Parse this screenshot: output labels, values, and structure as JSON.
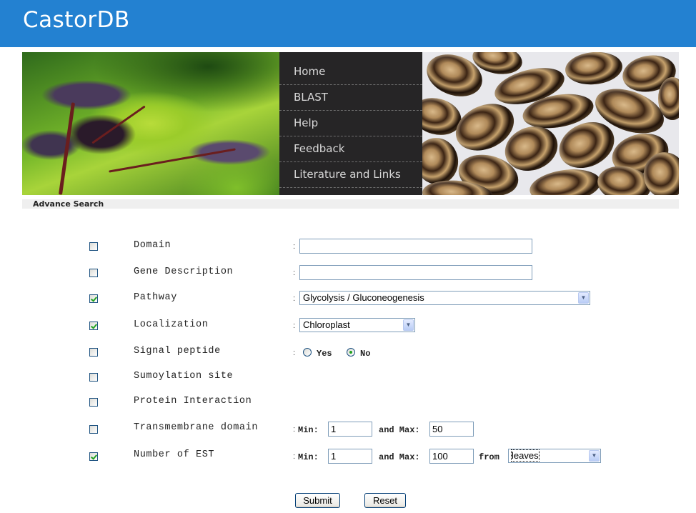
{
  "header": {
    "title": "CastorDB",
    "color": "#2381d1"
  },
  "nav": {
    "items": [
      {
        "label": "Home"
      },
      {
        "label": "BLAST"
      },
      {
        "label": "Help"
      },
      {
        "label": "Feedback"
      },
      {
        "label": "Literature and Links"
      }
    ]
  },
  "subbar": {
    "title": "Advance Search"
  },
  "form": {
    "separator": ":",
    "domain": {
      "label": "Domain",
      "checked": false,
      "value": ""
    },
    "gene_description": {
      "label": "Gene Description",
      "checked": false,
      "value": ""
    },
    "pathway": {
      "label": "Pathway",
      "checked": true,
      "selected": "Glycolysis / Gluconeogenesis"
    },
    "localization": {
      "label": "Localization",
      "checked": true,
      "selected": "Chloroplast"
    },
    "signal_peptide": {
      "label": "Signal peptide",
      "checked": false,
      "options": [
        {
          "label": "Yes",
          "selected": false
        },
        {
          "label": "No",
          "selected": true
        }
      ]
    },
    "sumoylation": {
      "label": "Sumoylation site",
      "checked": false
    },
    "protein_interaction": {
      "label": "Protein Interaction",
      "checked": false
    },
    "transmembrane": {
      "label": "Transmembrane domain",
      "checked": false,
      "min_label": "Min:",
      "min": "1",
      "max_label": "and Max:",
      "max": "50"
    },
    "est": {
      "label": "Number of EST",
      "checked": true,
      "min_label": "Min:",
      "min": "1",
      "max_label": "and Max:",
      "max": "100",
      "from_label": "from",
      "from_selected": "leaves"
    }
  },
  "buttons": {
    "submit": "Submit",
    "reset": "Reset"
  },
  "icons": {
    "dropdown": "chevron-down-icon",
    "check": "check-icon"
  }
}
